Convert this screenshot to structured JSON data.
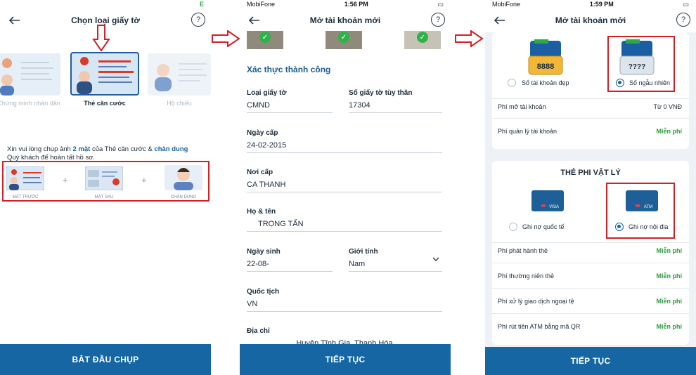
{
  "screen1": {
    "title": "Chọn loại giấy tờ",
    "status_icon": "E",
    "id_types": [
      "Chứng minh nhân dân",
      "Thẻ căn cước",
      "Hộ chiếu"
    ],
    "instruction_line1_prefix": "Xin vui lòng chụp ảnh ",
    "instruction_highlight1": "2 mặt",
    "instruction_line1_mid": " của Thẻ căn cước & ",
    "instruction_highlight2": "chân dung",
    "instruction_line2": "Quý khách để hoàn tất hồ sơ.",
    "photo_labels": [
      "MẶT TRƯỚC",
      "MẶT SAU",
      "CHÂN DUNG"
    ],
    "plus": "+",
    "button": "BẮT ĐẦU CHỤP",
    "help": "?"
  },
  "screen2": {
    "carrier": "MobiFone",
    "time": "1:56 PM",
    "title": "Mở tài khoản mới",
    "heading": "Xác thực thành công",
    "fields": {
      "doc_type_label": "Loại giấy tờ",
      "doc_type_value": "CMND",
      "id_no_label": "Số giấy tờ tùy thân",
      "id_no_value": "17304",
      "issue_date_label": "Ngày cấp",
      "issue_date_value": "24-02-2015",
      "issue_place_label": "Nơi cấp",
      "issue_place_value": "CA THANH",
      "name_label": "Họ & tên",
      "name_value": "TRỌNG TẤN",
      "dob_label": "Ngày sinh",
      "dob_value": "22-08-",
      "gender_label": "Giới tính",
      "gender_value": "Nam",
      "nationality_label": "Quốc tịch",
      "nationality_value": "VN",
      "address_label": "Địa chỉ",
      "address_value": "Huyện Tĩnh Gia, Thanh Hóa"
    },
    "check": "✓",
    "button": "TIẾP TỤC",
    "help": "?"
  },
  "screen3": {
    "carrier": "MobiFone",
    "time": "1:59 PM",
    "title": "Mở tài khoản mới",
    "account_options": [
      "Số tài khoản đẹp",
      "Số ngẫu nhiên"
    ],
    "account_selected": "Số ngẫu nhiên",
    "wallet_numbers": [
      "8888",
      "????"
    ],
    "account_fees": [
      {
        "label": "Phí mở tài khoản",
        "value": "Từ 0 VNĐ"
      },
      {
        "label": "Phí quản lý tài khoản",
        "value": "Miễn phí"
      }
    ],
    "card_section_title": "THẺ PHI VẬT LÝ",
    "card_options": [
      "Ghi nợ quốc tế",
      "Ghi nợ nội địa"
    ],
    "card_selected": "Ghi nợ nội địa",
    "card_brands": [
      "VISA",
      "ATM"
    ],
    "card_fees": [
      {
        "label": "Phí phát hành thẻ",
        "value": "Miễn phí"
      },
      {
        "label": "Phí thường niên thẻ",
        "value": "Miễn phí"
      },
      {
        "label": "Phí xử lý giao dịch ngoại tệ",
        "value": "Miễn phí"
      },
      {
        "label": "Phí rút tiền ATM bằng mã QR",
        "value": "Miễn phí"
      }
    ],
    "button": "TIẾP TỤC",
    "help": "?"
  },
  "colors": {
    "primary": "#1566a3",
    "highlight_red": "#d41f26",
    "free_green": "#2f9d3f",
    "check_green": "#2db34a"
  }
}
